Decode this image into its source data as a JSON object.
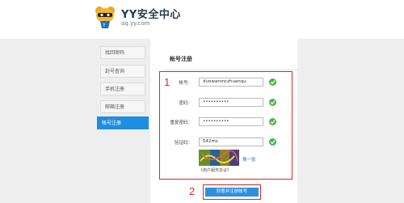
{
  "header": {
    "title": "YY安全中心",
    "url": "aq.yy.com",
    "logo_icon": "yy-bear-logo-icon"
  },
  "sidebar": {
    "items": [
      {
        "label": "找回密码",
        "active": false
      },
      {
        "label": "封号查询",
        "active": false
      },
      {
        "label": "手机注册",
        "active": false
      },
      {
        "label": "邮箱注册",
        "active": false
      },
      {
        "label": "帐号注册",
        "active": true
      }
    ]
  },
  "form": {
    "title": "帐号注册",
    "account_label": "帐号：",
    "account_value": "duowanmczhuanqu",
    "password_label": "密码：",
    "password_value": "••••••••••",
    "confirm_label": "重复密码：",
    "confirm_value": "••••••••••",
    "captcha_label": "验证码：",
    "captcha_value": "542ms",
    "captcha_refresh": "换一张",
    "agreement_text": "《用户服务协议》",
    "submit_label": "同意并注册帐号"
  },
  "annotations": {
    "marker_1": "1",
    "marker_2": "2"
  },
  "colors": {
    "accent": "#1e8ee0",
    "annotation_red": "#d9281f",
    "valid_green": "#4cb34c"
  }
}
